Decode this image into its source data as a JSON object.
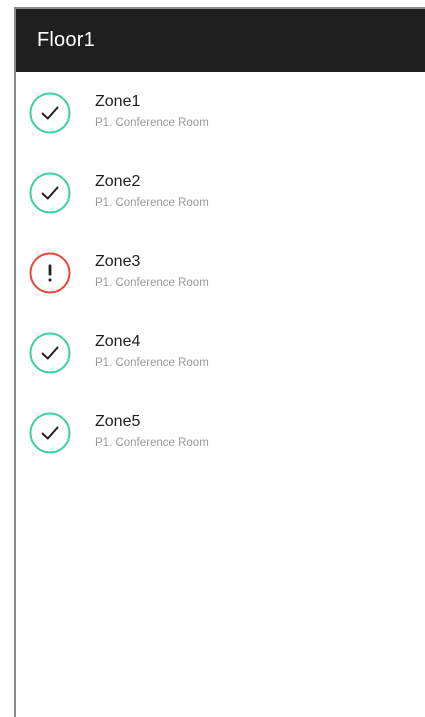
{
  "appbar": {
    "title": "Floor1"
  },
  "colors": {
    "ok": "#3ccfa3",
    "alert": "#e5473a",
    "appbar": "#1f1f1f"
  },
  "zones": [
    {
      "name": "Zone1",
      "location": "P1. Conference Room",
      "status": "ok",
      "icon": "check-circle-icon"
    },
    {
      "name": "Zone2",
      "location": "P1. Conference Room",
      "status": "ok",
      "icon": "check-circle-icon"
    },
    {
      "name": "Zone3",
      "location": "P1. Conference Room",
      "status": "alert",
      "icon": "alert-circle-icon"
    },
    {
      "name": "Zone4",
      "location": "P1. Conference Room",
      "status": "ok",
      "icon": "check-circle-icon"
    },
    {
      "name": "Zone5",
      "location": "P1. Conference Room",
      "status": "ok",
      "icon": "check-circle-icon"
    }
  ]
}
